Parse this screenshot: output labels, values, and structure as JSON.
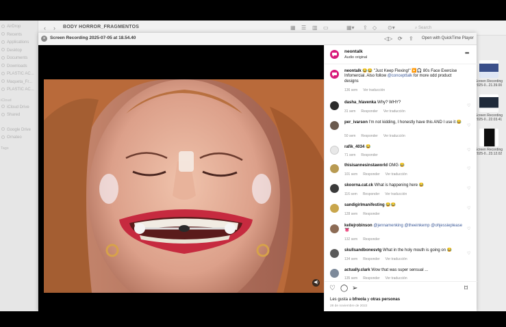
{
  "finder": {
    "title": "BODY HORROR_FRAGMENTOS",
    "search_placeholder": "Search",
    "sidebar": {
      "items": [
        "AirDrop",
        "Recents",
        "Applications",
        "Desktop",
        "Documents",
        "Downloads",
        "PLASTIC AC...",
        "Maqueta_Fr...",
        "PLASTIC AC..."
      ],
      "cloud_head": "iCloud",
      "cloud_items": [
        "iCloud Drive",
        "Shared"
      ],
      "loc_items": [
        "Google Drive",
        "Ornateo"
      ],
      "tags_head": "Tags"
    },
    "files": [
      {
        "name_line1": "Screen Recording",
        "name_line2": "2025-0...21.39.00"
      },
      {
        "name_line1": "Screen Recording",
        "name_line2": "2025-0...22.03.41"
      },
      {
        "name_line1": "Screen Recording",
        "name_line2": "2025-0...23.12.02"
      }
    ]
  },
  "quicklook": {
    "title": "Screen Recording 2025-07-05 at 18.54.40",
    "open_label": "Open with QuickTime Player"
  },
  "post": {
    "username": "neontalk",
    "audio": "Audio original",
    "caption_user": "neontalk",
    "caption_text": "😂😂 \"Just Keep Flexing!\" ▶️🎧 80s Face Exercise Infomercial. Also follow",
    "caption_link": "@concepttalk",
    "caption_tail": "for more odd product designs",
    "caption_time": "136 sem",
    "caption_translate": "Ver traducción",
    "reply_label": "Responder",
    "translate_label": "Ver traducción",
    "comments": [
      {
        "user": "dasha_hlavenka",
        "text": "Why? WHY?",
        "time": "31 sem"
      },
      {
        "user": "per_ivarson",
        "text": "I'm not kidding, I honestly have this AND I use it 😂",
        "time": "50 sem"
      },
      {
        "user": "rafik_4034",
        "text": "😂",
        "time": "71 sem"
      },
      {
        "user": "thisisannesinstaworld",
        "text": "OMG 😂",
        "time": "101 sem"
      },
      {
        "user": "skoorna.cat.ck",
        "text": "What is happening here 😂",
        "time": "116 sem"
      },
      {
        "user": "sandigirlmanifesting",
        "text": "😂😂",
        "time": "128 sem"
      },
      {
        "user": "kellejrobinson",
        "link": "@jennamenking @theeinkemp @ohjessieplease",
        "text": "👅",
        "time": "132 sem"
      },
      {
        "user": "skullsandbonesvtg",
        "text": "What in the holy mouth is going on 😂",
        "time": "134 sem"
      },
      {
        "user": "actually.clark",
        "text": "Wow that was super sensual ...",
        "time": "135 sem"
      }
    ],
    "likes_prefix": "Les gusta a",
    "likes_user": "bfreola",
    "likes_middle": "y",
    "likes_others": "otras personas",
    "date": "28 de noviembre de 2022"
  },
  "colors": {
    "avatar_main": "#d81b7a",
    "link": "#3b5998"
  }
}
